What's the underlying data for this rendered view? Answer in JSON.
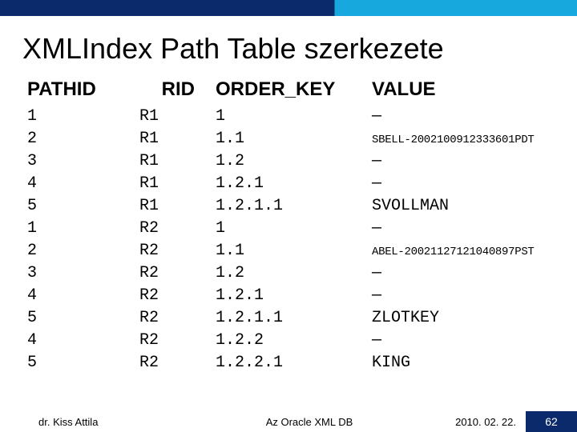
{
  "header": {
    "title": "XMLIndex Path Table szerkezete"
  },
  "columns": {
    "pathid": "PATHID",
    "rid": "RID",
    "order_key": "ORDER_KEY",
    "value": "VALUE"
  },
  "rows": [
    {
      "pathid": "1",
      "rid": "R1",
      "order_key": "1",
      "value": "—",
      "small": false
    },
    {
      "pathid": "2",
      "rid": "R1",
      "order_key": "1.1",
      "value": "SBELL-2002100912333601PDT",
      "small": true
    },
    {
      "pathid": "3",
      "rid": "R1",
      "order_key": "1.2",
      "value": "—",
      "small": false
    },
    {
      "pathid": "4",
      "rid": "R1",
      "order_key": "1.2.1",
      "value": "—",
      "small": false
    },
    {
      "pathid": "5",
      "rid": "R1",
      "order_key": "1.2.1.1",
      "value": "SVOLLMAN",
      "small": false
    },
    {
      "pathid": "1",
      "rid": "R2",
      "order_key": "1",
      "value": "—",
      "small": false
    },
    {
      "pathid": "2",
      "rid": "R2",
      "order_key": "1.1",
      "value": "ABEL-20021127121040897PST",
      "small": true
    },
    {
      "pathid": "3",
      "rid": "R2",
      "order_key": "1.2",
      "value": "—",
      "small": false
    },
    {
      "pathid": "4",
      "rid": "R2",
      "order_key": "1.2.1",
      "value": "—",
      "small": false
    },
    {
      "pathid": "5",
      "rid": "R2",
      "order_key": "1.2.1.1",
      "value": "ZLOTKEY",
      "small": false
    },
    {
      "pathid": "4",
      "rid": "R2",
      "order_key": "1.2.2",
      "value": "—",
      "small": false
    },
    {
      "pathid": "5",
      "rid": "R2",
      "order_key": "1.2.2.1",
      "value": "KING",
      "small": false
    }
  ],
  "footer": {
    "author": "dr. Kiss Attila",
    "center": "Az Oracle XML DB",
    "date": "2010. 02. 22.",
    "page": "62"
  }
}
